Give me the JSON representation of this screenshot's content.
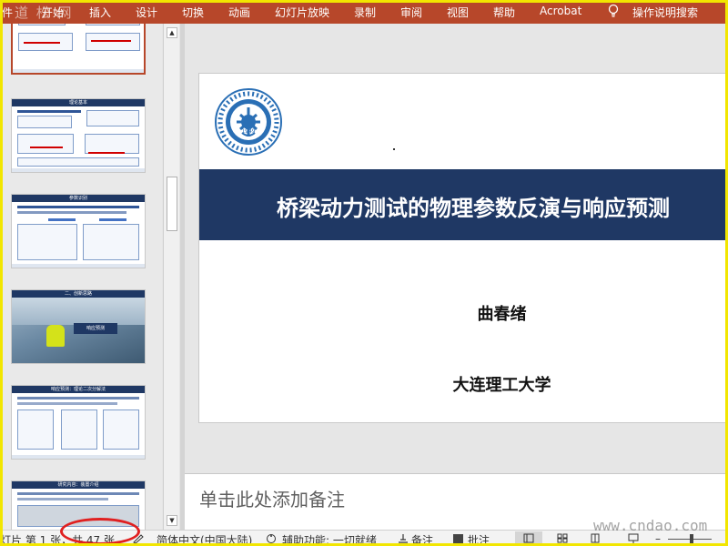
{
  "ribbon": {
    "tabs": [
      "件",
      "开始",
      "插入",
      "设计",
      "切换",
      "动画",
      "幻灯片放映",
      "录制",
      "审阅",
      "视图",
      "帮助",
      "Acrobat"
    ],
    "tell_me": "操作说明搜索",
    "watermark": "道 松 网",
    "bg_color": "#b7472a"
  },
  "thumbnails": [
    {
      "title": "",
      "kind": "diagram",
      "selected": true
    },
    {
      "title": "理论基本",
      "kind": "diagram"
    },
    {
      "title": "参数识别",
      "kind": "diagram"
    },
    {
      "title": "二、创新思路",
      "kind": "photo",
      "label": "响应预测"
    },
    {
      "title": "响应预测：理论二次分解法",
      "kind": "diagram"
    },
    {
      "title": "研究内容：装置介绍",
      "kind": "diagram"
    }
  ],
  "slide": {
    "title": "桥梁动力测试的物理参数反演与响应预测",
    "author": "曲春绪",
    "organization": "大连理工大学",
    "banner_color": "#1f3864",
    "logo": {
      "year": "1949",
      "ring_text": "DALIAN UNIVERSITY OF TECHNOLOGY"
    }
  },
  "notes": {
    "placeholder": "单击此处添加备注"
  },
  "status": {
    "slide_info": "灯片 第 1 张，共 47 张",
    "language": "简体中文(中国大陆)",
    "accessibility": "辅助功能: 一切就绪",
    "notes": "备注",
    "comments": "批注",
    "watermark": "www.cndao.com"
  }
}
